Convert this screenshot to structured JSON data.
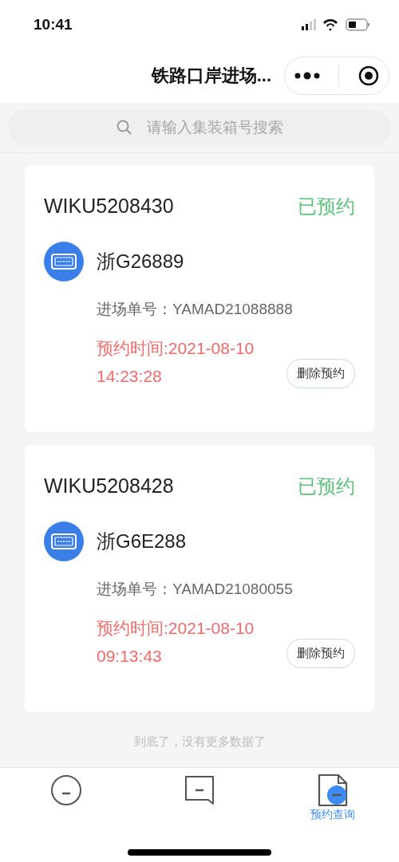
{
  "status_bar": {
    "time": "10:41"
  },
  "nav_bar": {
    "title": "铁路口岸进场..."
  },
  "search": {
    "placeholder": "请输入集装箱号搜索"
  },
  "bookings": [
    {
      "container_no": "WIKU5208430",
      "status": "已预约",
      "plate": "浙G26889",
      "order_label": "进场单号：",
      "order_no": "YAMAD21088888",
      "time_label": "预约时间:",
      "time": "2021-08-10 14:23:28",
      "action": "删除预约"
    },
    {
      "container_no": "WIKU5208428",
      "status": "已预约",
      "plate": "浙G6E288",
      "order_label": "进场单号：",
      "order_no": "YAMAD21080055",
      "time_label": "预约时间:",
      "time": "2021-08-10 09:13:43",
      "action": "删除预约"
    }
  ],
  "end_note": "到底了，没有更多数据了",
  "tabs": [
    {
      "kind": "circle",
      "selected": false
    },
    {
      "kind": "chat",
      "selected": false
    },
    {
      "kind": "doc",
      "label": "预约查询",
      "selected": true
    }
  ]
}
